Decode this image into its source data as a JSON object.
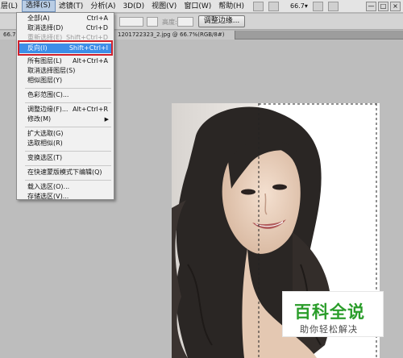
{
  "menubar": {
    "items": [
      "层(L)",
      "选择(S)",
      "滤镜(T)",
      "分析(A)",
      "3D(D)",
      "视图(V)",
      "窗口(W)",
      "帮助(H)"
    ],
    "zoom_value": "66.7",
    "window_buttons": [
      "—",
      "□",
      "×"
    ]
  },
  "options_bar": {
    "width_label": "高度:",
    "refine_edge_label": "调整边缘..."
  },
  "doc_tabs": [
    {
      "title": "66.7"
    },
    {
      "title": "1201722323_2.jpg @ 66.7%(RGB/8#)"
    }
  ],
  "select_menu": {
    "items": [
      {
        "label": "全部(A)",
        "shortcut": "Ctrl+A",
        "state": "normal"
      },
      {
        "label": "取消选择(D)",
        "shortcut": "Ctrl+D",
        "state": "normal"
      },
      {
        "label": "重新选择(E)",
        "shortcut": "Shift+Ctrl+D",
        "state": "disabled"
      },
      {
        "label": "反向(I)",
        "shortcut": "Shift+Ctrl+I",
        "state": "highlighted"
      },
      {
        "label": "所有图层(L)",
        "shortcut": "Alt+Ctrl+A",
        "state": "normal"
      },
      {
        "label": "取消选择图层(S)",
        "shortcut": "",
        "state": "normal"
      },
      {
        "label": "相似图层(Y)",
        "shortcut": "",
        "state": "normal"
      },
      {
        "label": "色彩范围(C)...",
        "shortcut": "",
        "state": "normal"
      },
      {
        "label": "调整边缘(F)...",
        "shortcut": "Alt+Ctrl+R",
        "state": "normal"
      },
      {
        "label": "修改(M)",
        "shortcut": "",
        "state": "submenu"
      },
      {
        "label": "扩大选取(G)",
        "shortcut": "",
        "state": "normal"
      },
      {
        "label": "选取相似(R)",
        "shortcut": "",
        "state": "normal"
      },
      {
        "label": "变换选区(T)",
        "shortcut": "",
        "state": "normal"
      },
      {
        "label": "在快速蒙版模式下编辑(Q)",
        "shortcut": "",
        "state": "normal"
      },
      {
        "label": "载入选区(O)...",
        "shortcut": "",
        "state": "normal"
      },
      {
        "label": "存储选区(V)...",
        "shortcut": "",
        "state": "normal"
      }
    ]
  },
  "watermark": {
    "title": "百科全说",
    "subtitle": "助你轻松解决"
  },
  "colors": {
    "highlight": "#3d8ee8",
    "annotation_red": "#d0202c",
    "watermark_green": "#2a9d2a"
  }
}
